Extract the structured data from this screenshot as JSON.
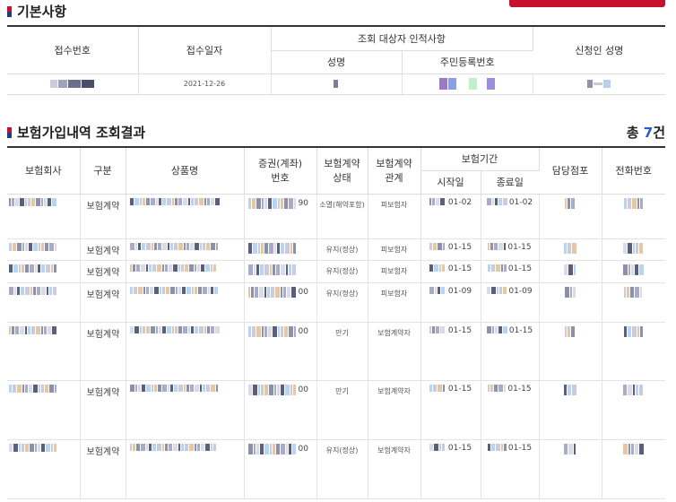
{
  "basic": {
    "title": "기본사항",
    "headers": {
      "receipt_no": "접수번호",
      "receipt_date": "접수일자",
      "target_group": "조회 대상자 인적사항",
      "name": "성명",
      "rrn": "주민등록번호",
      "applicant": "신청인 성명"
    },
    "row": {
      "receipt_date": "2021-12-26"
    }
  },
  "results": {
    "title": "보험가입내역 조회결과",
    "total_prefix": "총 ",
    "total_count": "7",
    "total_suffix": "건",
    "headers": {
      "company": "보험회사",
      "kind": "구분",
      "product": "상품명",
      "policy_no_1": "증권(계좌)",
      "policy_no_2": "번호",
      "status_1": "보험계약",
      "status_2": "상태",
      "relation_1": "보험계약",
      "relation_2": "관계",
      "period": "보험기간",
      "start": "시작일",
      "end": "종료일",
      "branch": "담당점포",
      "phone": "전화번호"
    },
    "rows": [
      {
        "kind": "보험계약",
        "policy_suffix": "90",
        "status": "소멸(해약포함)",
        "relation": "피보험자",
        "start": "01-02",
        "end": "01-02"
      },
      {
        "kind": "보험계약",
        "policy_suffix": "",
        "status": "유지(정상)",
        "relation": "피보험자",
        "start": "01-15",
        "end": "01-15"
      },
      {
        "kind": "보험계약",
        "policy_suffix": "",
        "status": "유지(정상)",
        "relation": "피보험자",
        "start": "01-15",
        "end": "01-15"
      },
      {
        "kind": "보험계약",
        "policy_suffix": "00",
        "status": "유지(정상)",
        "relation": "피보험자",
        "start": "01-09",
        "end": "01-09"
      },
      {
        "kind": "보험계약",
        "policy_suffix": "00",
        "status": "만기",
        "relation": "보험계약자",
        "start": "01-15",
        "end": "01-15"
      },
      {
        "kind": "보험계약",
        "policy_suffix": "00",
        "status": "만기",
        "relation": "보험계약자",
        "start": "01-15",
        "end": "01-15"
      },
      {
        "kind": "보험계약",
        "policy_suffix": "00",
        "status": "유지(정상)",
        "relation": "보험계약자",
        "start": "01-15",
        "end": "01-15"
      }
    ]
  }
}
